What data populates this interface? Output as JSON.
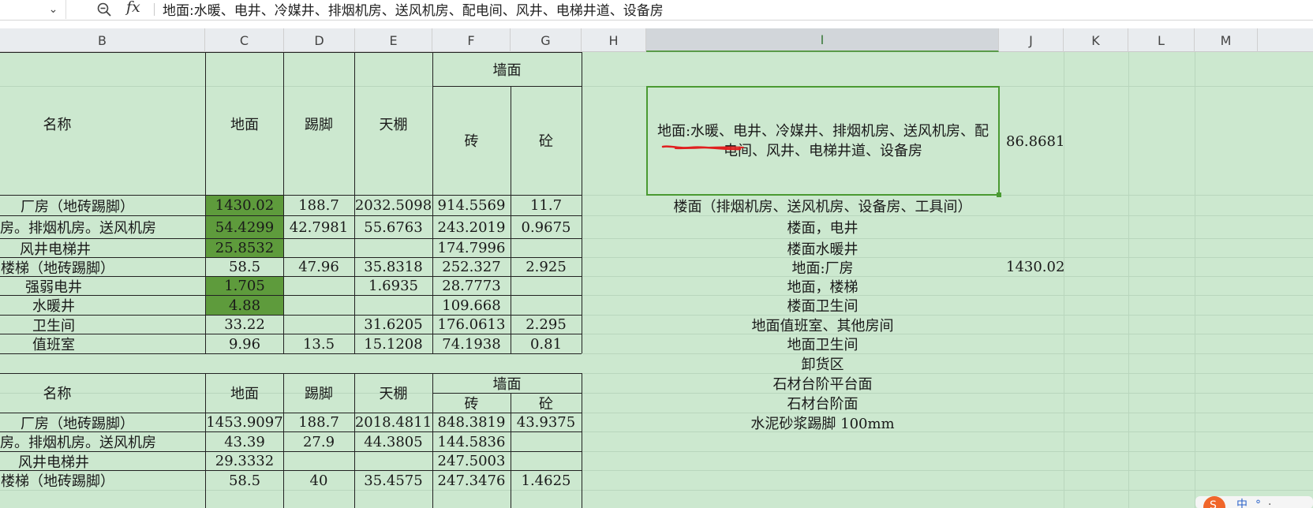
{
  "formula_bar": {
    "namebox_dropdown": "⌄",
    "fx_label": "fx",
    "formula": "地面:水暖、电井、冷媒井、排烟机房、送风机房、配电间、风井、电梯井道、设备房"
  },
  "columns": [
    "B",
    "C",
    "D",
    "E",
    "F",
    "G",
    "H",
    "I",
    "J",
    "K",
    "L",
    "M"
  ],
  "table1": {
    "header": {
      "name": "名称",
      "floor": "地面",
      "skirting": "踢脚",
      "ceiling": "天棚",
      "wall": "墙面",
      "brick": "砖",
      "concrete": "砼"
    },
    "rows": [
      {
        "name": "厂房（地砖踢脚）",
        "c": "1430.02",
        "d": "188.7",
        "e": "2032.5098",
        "f": "914.5569",
        "g": "11.7"
      },
      {
        "name": "房。排烟机房。送风机房",
        "c": "54.4299",
        "d": "42.7981",
        "e": "55.6763",
        "f": "243.2019",
        "g": "0.9675"
      },
      {
        "name": "风井电梯井",
        "c": "25.8532",
        "d": "",
        "e": "",
        "f": "174.7996",
        "g": ""
      },
      {
        "name": "楼梯（地砖踢脚）",
        "c": "58.5",
        "d": "47.96",
        "e": "35.8318",
        "f": "252.327",
        "g": "2.925"
      },
      {
        "name": "强弱电井",
        "c": "1.705",
        "d": "",
        "e": "1.6935",
        "f": "28.7773",
        "g": ""
      },
      {
        "name": "水暖井",
        "c": "4.88",
        "d": "",
        "e": "",
        "f": "109.668",
        "g": ""
      },
      {
        "name": "卫生间",
        "c": "33.22",
        "d": "",
        "e": "31.6205",
        "f": "176.0613",
        "g": "2.295"
      },
      {
        "name": "值班室",
        "c": "9.96",
        "d": "13.5",
        "e": "15.1208",
        "f": "74.1938",
        "g": "0.81"
      }
    ]
  },
  "table2": {
    "header": {
      "name": "名称",
      "floor": "地面",
      "skirting": "踢脚",
      "ceiling": "天棚",
      "wall": "墙面",
      "brick": "砖",
      "concrete": "砼"
    },
    "rows": [
      {
        "name": "厂房（地砖踢脚）",
        "c": "1453.9097",
        "d": "188.7",
        "e": "2018.4811",
        "f": "848.3819",
        "g": "43.9375"
      },
      {
        "name": "房。排烟机房。送风机房",
        "c": "43.39",
        "d": "27.9",
        "e": "44.3805",
        "f": "144.5836",
        "g": ""
      },
      {
        "name": "风井电梯井",
        "c": "29.3332",
        "d": "",
        "e": "",
        "f": "247.5003",
        "g": ""
      },
      {
        "name": "楼梯（地砖踢脚）",
        "c": "58.5",
        "d": "40",
        "e": "35.4575",
        "f": "247.3476",
        "g": "1.4625"
      }
    ]
  },
  "column_i": {
    "selected_cell": "地面:水暖、电井、冷媒井、排烟机房、送风机房、配电间、风井、电梯井道、设备房",
    "selected_value_j": "86.8681",
    "items": [
      "楼面（排烟机房、送风机房、设备房、工具间）",
      "楼面，电井",
      "楼面水暖井",
      "地面:厂房",
      "地面，楼梯",
      "楼面卫生间",
      "地面值班室、其他房间",
      "地面卫生间",
      "卸货区",
      "石材台阶平台面",
      "石材台阶面",
      "水泥砂浆踢脚 100mm"
    ],
    "value_j_row4": "1430.02"
  },
  "colors": {
    "grid_bg": "#cce8cf",
    "highlight": "#5e9b3c",
    "selection_border": "#4a9a32",
    "annotation": "#e02020"
  }
}
